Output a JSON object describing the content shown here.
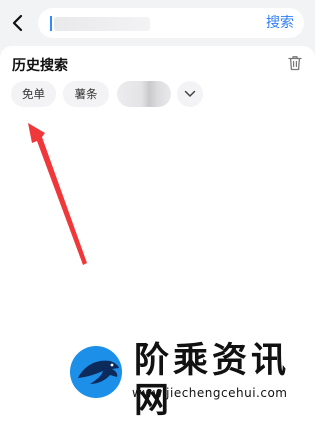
{
  "header": {
    "back_icon": "chevron-left-icon",
    "search": {
      "value": "",
      "placeholder": ""
    },
    "search_button_label": "搜索"
  },
  "history": {
    "title": "历史搜索",
    "clear_icon": "trash-icon",
    "chips": [
      {
        "label": "免单"
      },
      {
        "label": "薯条"
      }
    ],
    "expand_icon": "chevron-down-icon"
  },
  "annotation": {
    "arrow_color": "#f0383a"
  },
  "watermark": {
    "title": "阶乘资讯网",
    "url": "www.jiechengcehui.com"
  },
  "colors": {
    "accent": "#2f7ff7",
    "background": "#f2f3f5",
    "chip_bg": "#f3f3f5"
  }
}
